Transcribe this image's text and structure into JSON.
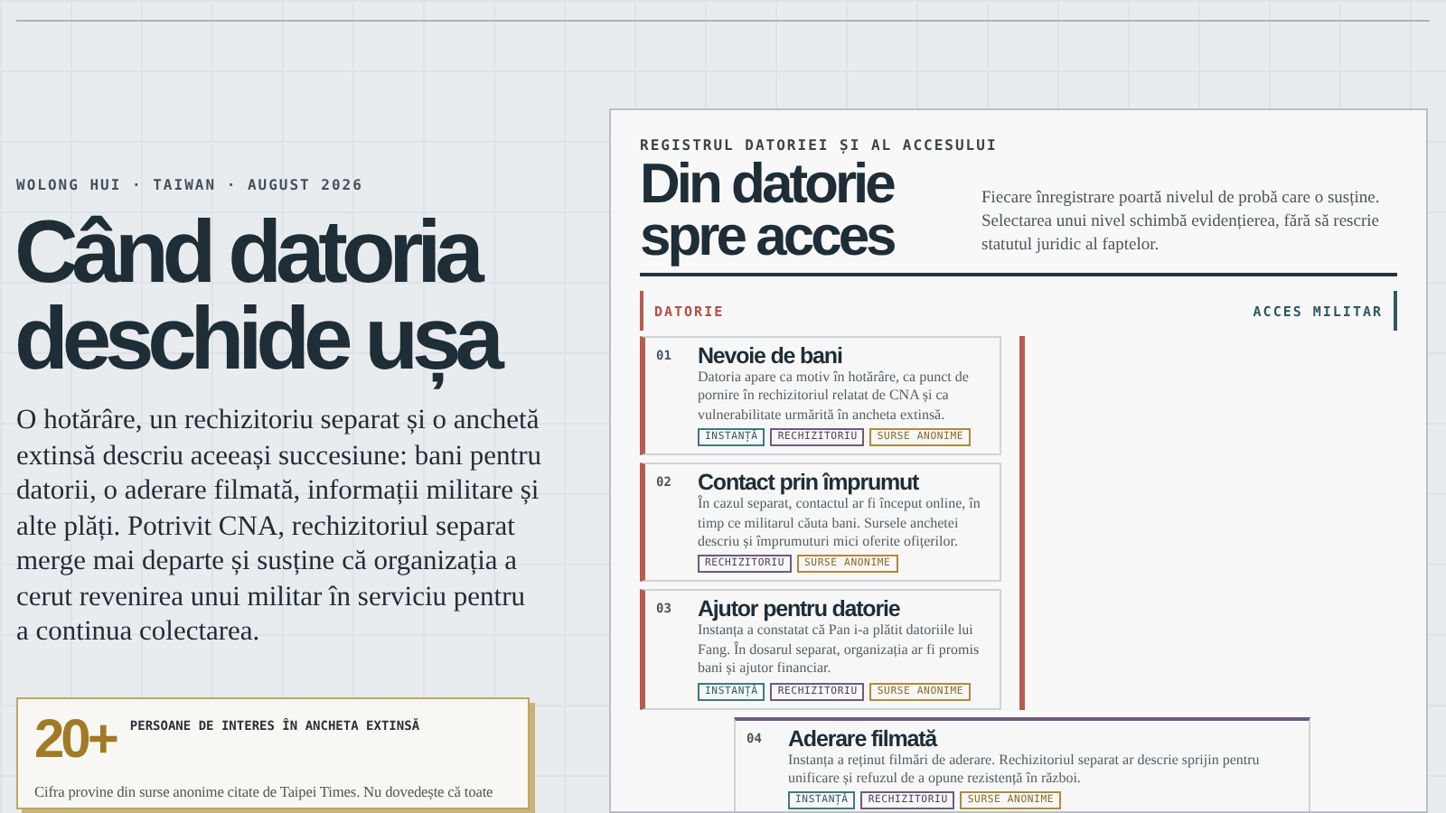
{
  "hero": {
    "byline": "WOLONG HUI · TAIWAN · AUGUST 2026",
    "headline": [
      "Când datoria",
      "deschide ușa"
    ],
    "lede": "O hotărâre, un rechizitoriu separat și o anchetă extinsă descriu aceeași succesiune: bani pentru datorii, o aderare filmată, informații militare și alte plăți. Potrivit CNA, rechizitoriul separat merge mai departe și susține că organizația a cerut revenirea unui militar în serviciu pentru a continua colectarea."
  },
  "stat": {
    "value": "20+",
    "label": "PERSOANE DE INTERES ÎN ANCHETA EXTINSĂ",
    "note": "Cifra provine din surse anonime citate de Taipei Times. Nu dovedește că toate"
  },
  "register": {
    "kicker": "REGISTRUL DATORIEI ȘI AL ACCESULUI",
    "title": [
      "Din datorie",
      "spre acces"
    ],
    "description": "Fiecare înregistrare poartă nivelul de probă care o susține. Selectarea unui nivel schimbă evidențierea, fără să rescrie statutul juridic al faptelor.",
    "axis_start": "DATORIE",
    "axis_end": "ACCES MILITAR",
    "entries": [
      {
        "number": "01",
        "title": "Nevoie de bani",
        "text": "Datoria apare ca motiv în hotărâre, ca punct de pornire în rechizitoriul relatat de CNA și ca vulnerabilitate urmărită în ancheta extinsă.",
        "kind": "debt",
        "tags": [
          {
            "label": "INSTANȚĂ",
            "kind": "court"
          },
          {
            "label": "RECHIZITORIU",
            "kind": "indictment"
          },
          {
            "label": "SURSE ANONIME",
            "kind": "anonymous"
          }
        ]
      },
      {
        "number": "02",
        "title": "Contact prin împrumut",
        "text": "În cazul separat, contactul ar fi început online, în timp ce militarul căuta bani. Sursele anchetei descriu și împrumuturi mici oferite ofițerilor.",
        "kind": "debt",
        "tags": [
          {
            "label": "RECHIZITORIU",
            "kind": "indictment"
          },
          {
            "label": "SURSE ANONIME",
            "kind": "anonymous"
          }
        ]
      },
      {
        "number": "03",
        "title": "Ajutor pentru datorie",
        "text": "Instanța a constatat că Pan i-a plătit datoriile lui Fang. În dosarul separat, organizația ar fi promis bani și ajutor financiar.",
        "kind": "debt",
        "tags": [
          {
            "label": "INSTANȚĂ",
            "kind": "court"
          },
          {
            "label": "RECHIZITORIU",
            "kind": "indictment"
          },
          {
            "label": "SURSE ANONIME",
            "kind": "anonymous"
          }
        ]
      },
      {
        "number": "04",
        "title": "Aderare filmată",
        "text": "Instanța a reținut filmări de aderare. Rechizitoriul separat ar descrie sprijin pentru unificare și refuzul de a opune rezistență în război.",
        "kind": "bridge",
        "tags": [
          {
            "label": "INSTANȚĂ",
            "kind": "court"
          },
          {
            "label": "RECHIZITORIU",
            "kind": "indictment"
          },
          {
            "label": "SURSE ANONIME",
            "kind": "anonymous"
          }
        ]
      }
    ]
  }
}
